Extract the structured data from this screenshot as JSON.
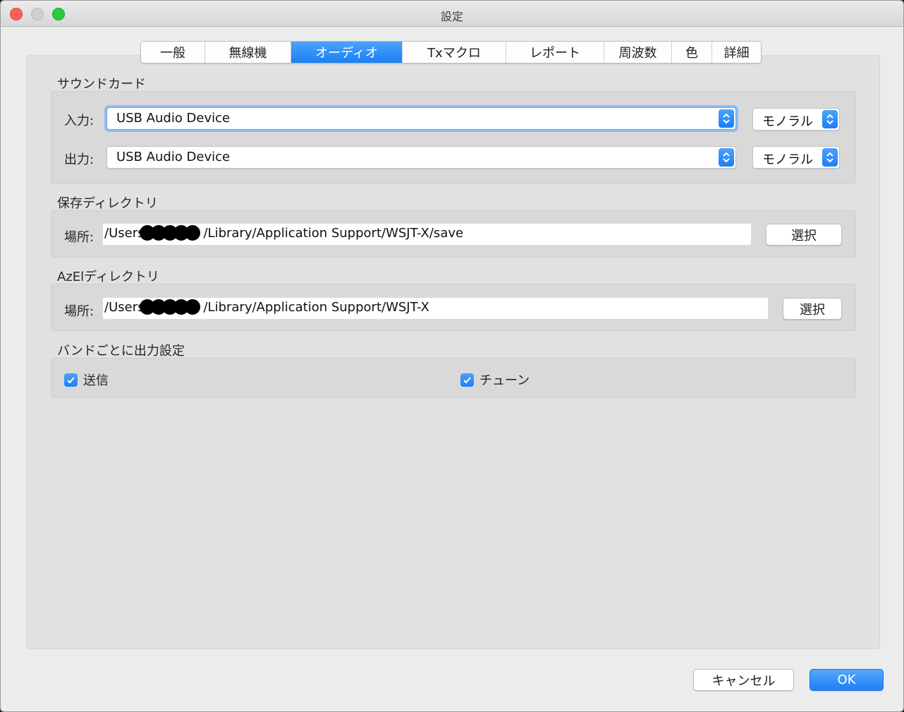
{
  "window": {
    "title": "設定"
  },
  "tabs": [
    {
      "label": "一般"
    },
    {
      "label": "無線機"
    },
    {
      "label": "オーディオ",
      "active": true
    },
    {
      "label": "Txマクロ"
    },
    {
      "label": "レポート"
    },
    {
      "label": "周波数"
    },
    {
      "label": "色"
    },
    {
      "label": "詳細"
    }
  ],
  "soundcard": {
    "title": "サウンドカード",
    "input": {
      "label": "入力:",
      "device": "USB Audio Device",
      "channel": "モノラル"
    },
    "output": {
      "label": "出力:",
      "device": "USB Audio Device",
      "channel": "モノラル"
    }
  },
  "save_dir": {
    "title": "保存ディレクトリ",
    "location_label": "場所:",
    "path_prefix": "/Users",
    "path_suffix": "/Library/Application Support/WSJT-X/save",
    "select_label": "選択"
  },
  "azel_dir": {
    "title": "AzElディレクトリ",
    "location_label": "場所:",
    "path_prefix": "/Users",
    "path_suffix": "/Library/Application Support/WSJT-X",
    "select_label": "選択"
  },
  "band_output": {
    "title": "バンドごとに出力設定",
    "transmit": {
      "label": "送信",
      "checked": true
    },
    "tune": {
      "label": "チューン",
      "checked": true
    }
  },
  "footer": {
    "cancel_label": "キャンセル",
    "ok_label": "OK"
  },
  "colors": {
    "accent": "#1c7ff5",
    "close": "#fc5f57",
    "maximize": "#2bc840"
  }
}
